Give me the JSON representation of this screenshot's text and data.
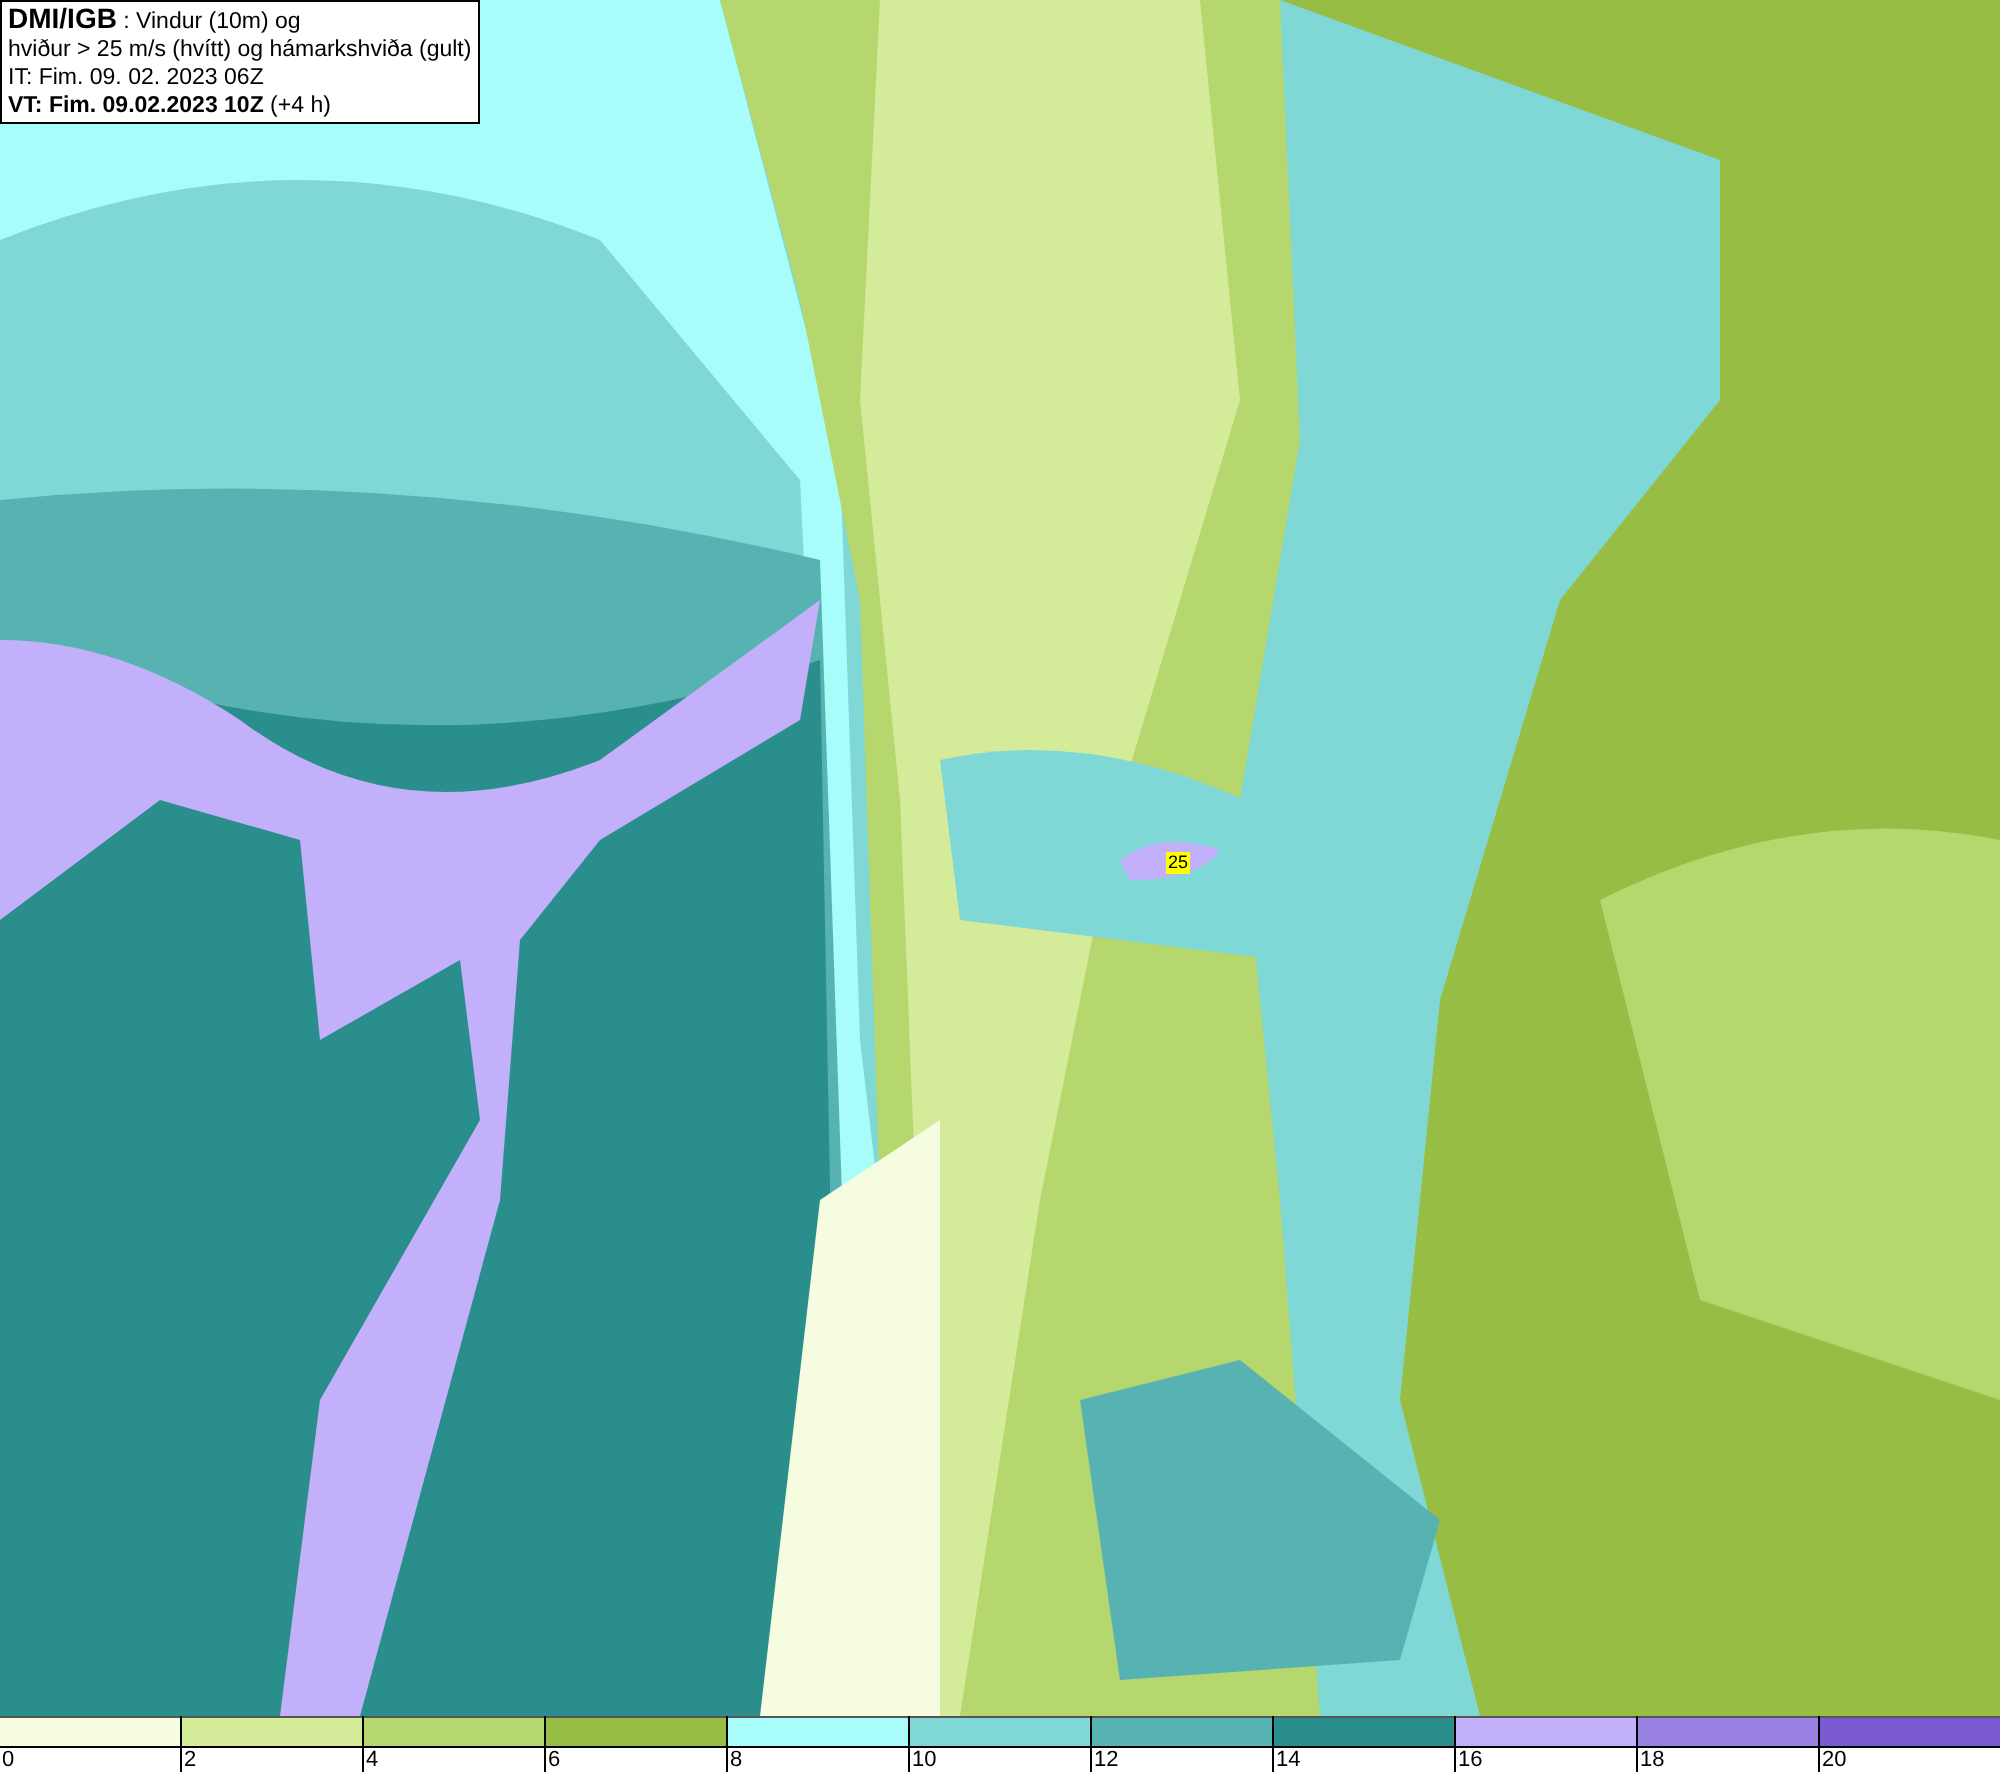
{
  "header": {
    "lines": [
      "**DMI/IGB** : Vindur (10m) og",
      "hviður > 25 m/s (hvítt) og hámarkshviða (gult)",
      "IT: Fim. 09. 02. 2023 06Z",
      "**VT: Fim. 09.02.2023 10Z** (+4 h)"
    ]
  },
  "map": {
    "gust_marker": "25"
  },
  "legend": {
    "bins": [
      {
        "color": "#f5fce0",
        "label": "0"
      },
      {
        "color": "#d4eb9a",
        "label": "2"
      },
      {
        "color": "#b6d66e",
        "label": "4"
      },
      {
        "color": "#97bd45",
        "label": "6"
      },
      {
        "color": "#a8fdfb",
        "label": "8"
      },
      {
        "color": "#80d8d6",
        "label": "10"
      },
      {
        "color": "#56b3b1",
        "label": "12"
      },
      {
        "color": "#2a8f8c",
        "label": "14"
      },
      {
        "color": "#c3b0fa",
        "label": "16"
      },
      {
        "color": "#9a82e4",
        "label": "18"
      },
      {
        "color": "#7a5bcf",
        "label": "20"
      }
    ]
  }
}
